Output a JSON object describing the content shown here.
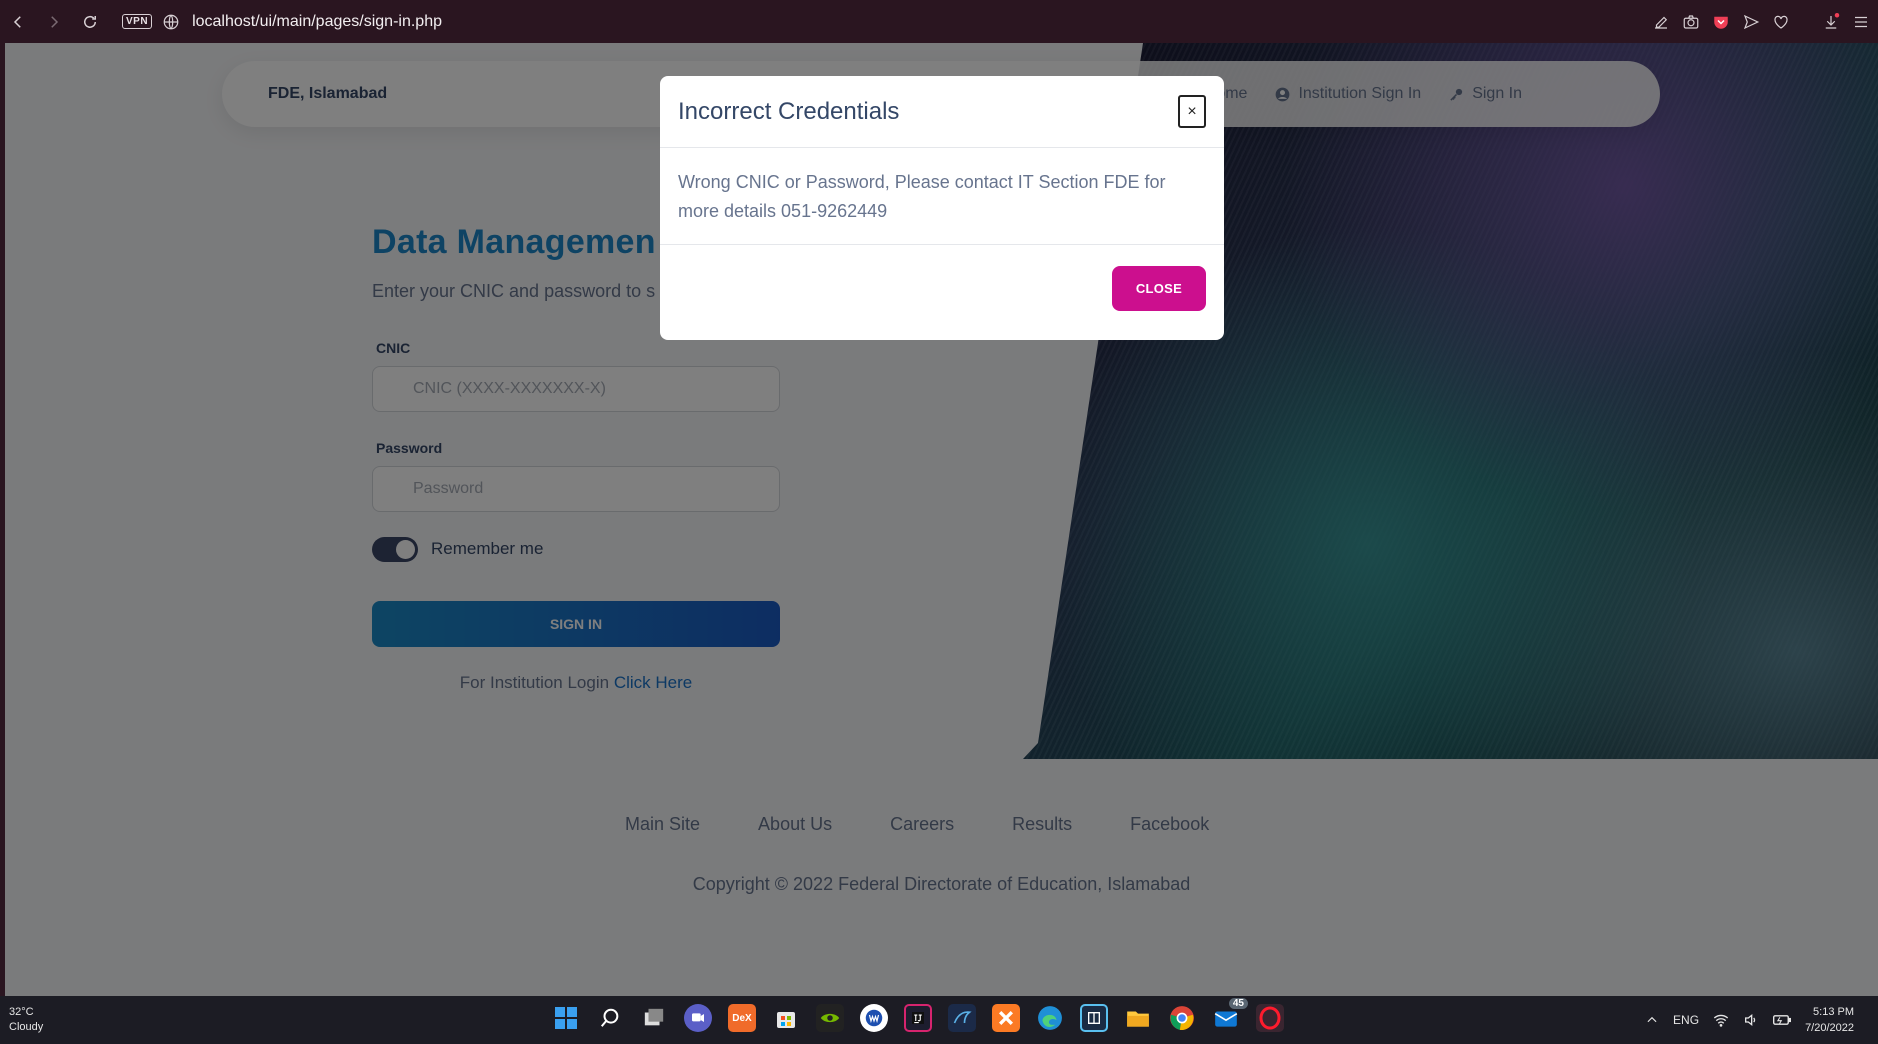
{
  "browser": {
    "vpn_label": "VPN",
    "url": "localhost/ui/main/pages/sign-in.php"
  },
  "navbar": {
    "brand": "FDE, Islamabad",
    "links": [
      "ome",
      "Institution Sign In",
      "Sign In"
    ]
  },
  "page": {
    "title": "Data Managemen",
    "subtitle": "Enter your CNIC and password to s",
    "cnic_label": "CNIC",
    "cnic_placeholder": "CNIC (XXXX-XXXXXXX-X)",
    "password_label": "Password",
    "password_placeholder": "Password",
    "remember_label": "Remember me",
    "remember_checked": true,
    "signin_label": "SIGN IN",
    "institution_text": "For Institution Login",
    "institution_link": "Click Here"
  },
  "footer": {
    "links": [
      "Main Site",
      "About Us",
      "Careers",
      "Results",
      "Facebook"
    ],
    "copyright": "Copyright © 2022 Federal Directorate of Education, Islamabad"
  },
  "modal": {
    "title": "Incorrect Credentials",
    "close_x": "×",
    "message_line1": "Wrong CNIC or Password, Please contact IT Section FDE for",
    "message_line2": "more details 051-9262449",
    "close_button": "CLOSE"
  },
  "taskbar": {
    "temperature": "32°C",
    "weather": "Cloudy",
    "language": "ENG",
    "time": "5:13 PM",
    "date": "7/20/2022",
    "dex_label": "DeX",
    "badge_count": "45"
  },
  "colors": {
    "brand_blue": "#1d87c8",
    "close_magenta": "#cc0f8e"
  }
}
